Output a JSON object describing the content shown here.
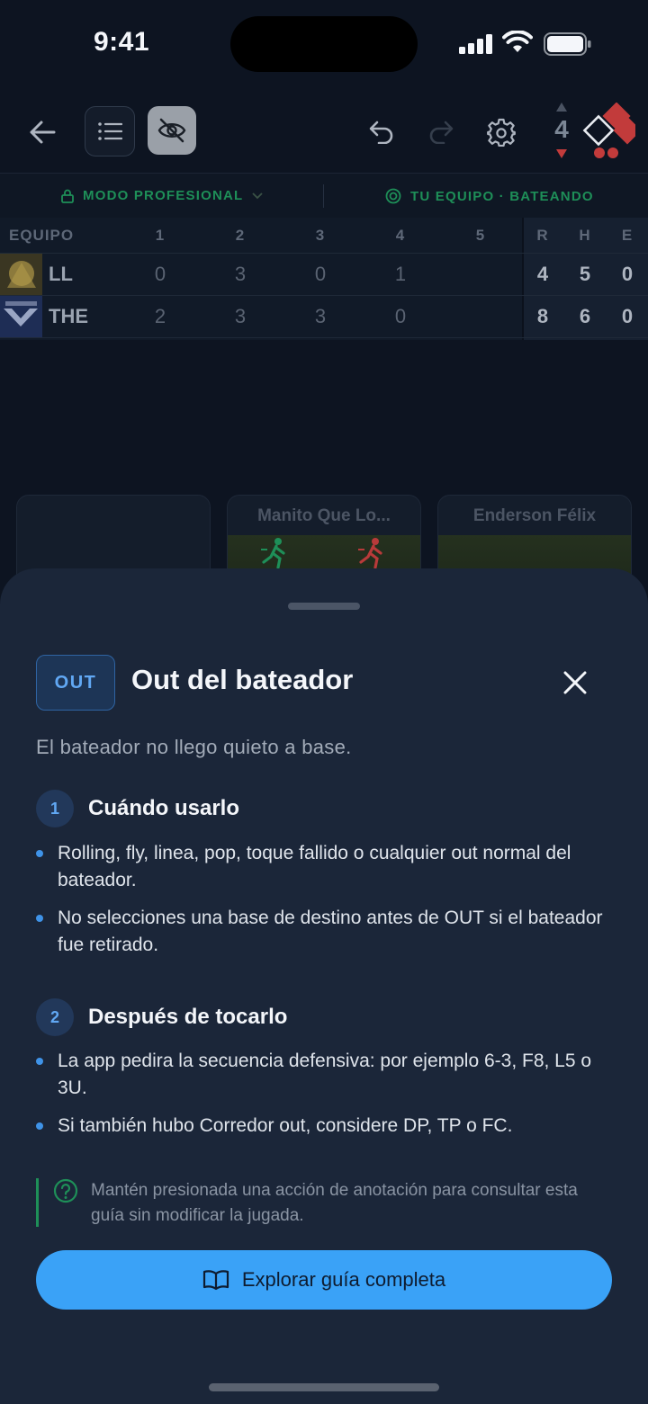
{
  "status": {
    "time": "9:41"
  },
  "toolbar": {
    "inning": "4"
  },
  "mode": {
    "left_label": "MODO PROFESIONAL",
    "right_label": "TU EQUIPO · BATEANDO"
  },
  "scoreboard": {
    "headers": [
      "EQUIPO",
      "1",
      "2",
      "3",
      "4",
      "5",
      "R",
      "H",
      "E"
    ],
    "rows": [
      {
        "team": "LL",
        "innings": [
          "0",
          "3",
          "0",
          "1",
          ""
        ],
        "r": "4",
        "h": "5",
        "e": "0"
      },
      {
        "team": "THE",
        "innings": [
          "2",
          "3",
          "3",
          "0",
          ""
        ],
        "r": "8",
        "h": "6",
        "e": "0"
      }
    ]
  },
  "cards": [
    {
      "name": ""
    },
    {
      "name": "Manito Que Lo..."
    },
    {
      "name": "Enderson Félix"
    }
  ],
  "sheet": {
    "badge": "OUT",
    "title": "Out del bateador",
    "subtitle": "El bateador no llego quieto a base.",
    "sections": [
      {
        "number": "1",
        "title": "Cuándo usarlo",
        "bullets": [
          "Rolling, fly, linea, pop, toque fallido o cualquier out normal del bateador.",
          "No selecciones una base de destino antes de OUT si el bateador fue retirado."
        ]
      },
      {
        "number": "2",
        "title": "Después de tocarlo",
        "bullets": [
          "La app pedira la secuencia defensiva: por ejemplo 6-3, F8, L5 o 3U.",
          "Si también hubo Corredor out, considere DP, TP o FC."
        ]
      }
    ],
    "tip": "Mantén presionada una acción de anotación para consultar esta guía sin modificar la jugada.",
    "cta_label": "Explorar guía completa"
  },
  "colors": {
    "accent": "#3aa2f7",
    "green": "#1e8f58",
    "red": "#c23b3b"
  }
}
